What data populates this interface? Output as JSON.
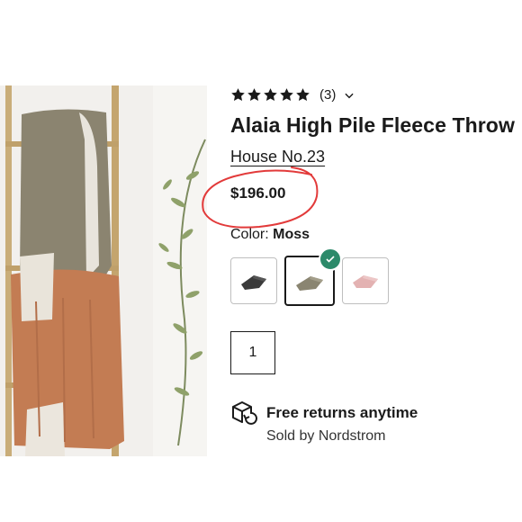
{
  "product_image": {
    "alt_icon": "blanket-ladder-photo"
  },
  "rating": {
    "stars": 5,
    "review_count": "(3)",
    "icon": "star-icon"
  },
  "product": {
    "title": "Alaia High Pile Fleece Throw",
    "brand": "House No.23",
    "price": "$196.00"
  },
  "color": {
    "label": "Color:",
    "selected": "Moss",
    "swatches": [
      {
        "name": "charcoal",
        "color": "#3b3b3b"
      },
      {
        "name": "moss",
        "color": "#8a8571"
      },
      {
        "name": "blush",
        "color": "#e3b2b2"
      }
    ],
    "check_color": "#2c8a6a"
  },
  "quantity": {
    "value": "1"
  },
  "shipping": {
    "returns_label": "Free returns anytime",
    "sold_by": "Sold by Nordstrom"
  },
  "annotation": {
    "circle_color": "#e23a3a"
  }
}
